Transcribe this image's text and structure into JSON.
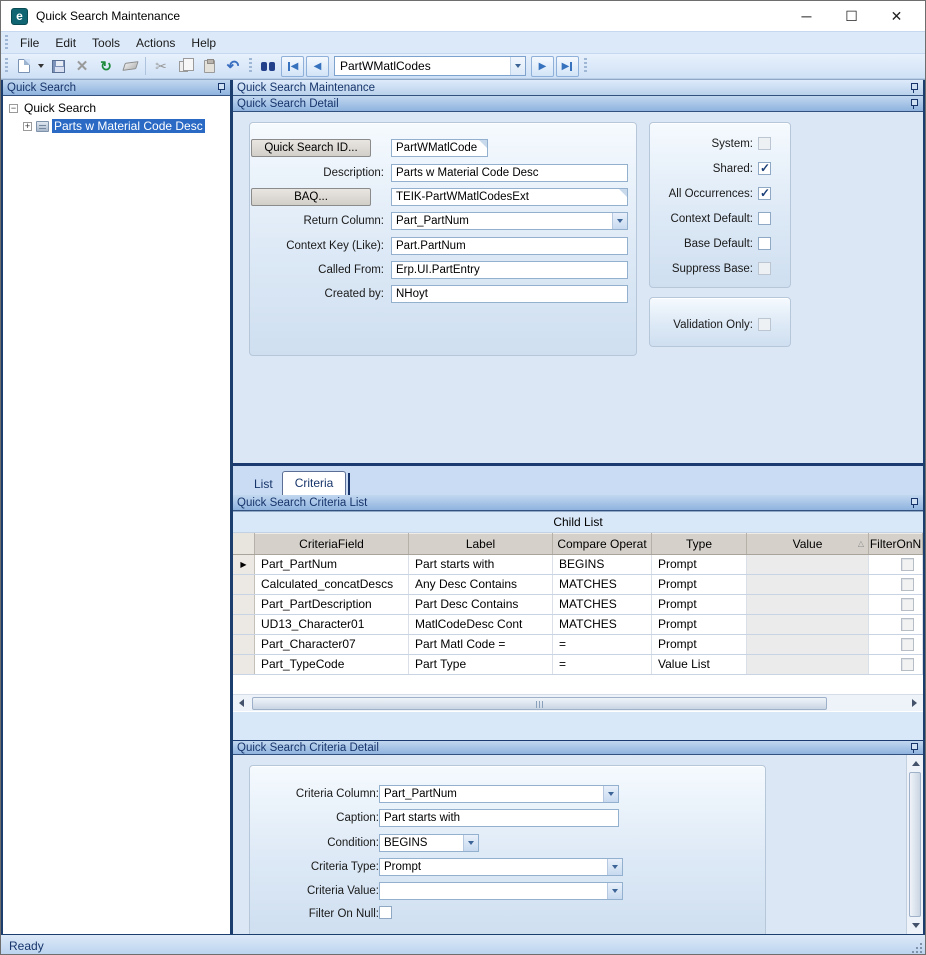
{
  "window": {
    "title": "Quick Search Maintenance",
    "status": "Ready"
  },
  "menu": {
    "items": [
      "File",
      "Edit",
      "Tools",
      "Actions",
      "Help"
    ]
  },
  "toolbar": {
    "record_combo_value": "PartWMatlCodes"
  },
  "tree": {
    "header": "Quick Search",
    "root_label": "Quick Search",
    "selected_node": "Parts w Material Code Desc"
  },
  "panel_headers": {
    "maintenance": "Quick Search Maintenance",
    "detail": "Quick Search Detail",
    "criteria_list": "Quick Search Criteria List",
    "criteria_detail": "Quick Search Criteria Detail"
  },
  "detail_form": {
    "id_button": "Quick Search ID...",
    "id_value": "PartWMatlCode",
    "description_label": "Description:",
    "description_value": "Parts w Material Code Desc",
    "baq_button": "BAQ...",
    "baq_value": "TEIK-PartWMatlCodesExt",
    "return_column_label": "Return Column:",
    "return_column_value": "Part_PartNum",
    "context_key_label": "Context Key (Like):",
    "context_key_value": "Part.PartNum",
    "called_from_label": "Called From:",
    "called_from_value": "Erp.UI.PartEntry",
    "created_by_label": "Created by:",
    "created_by_value": "NHoyt",
    "checkboxes": [
      {
        "label": "System:",
        "checked": false,
        "enabled": false
      },
      {
        "label": "Shared:",
        "checked": true,
        "enabled": true
      },
      {
        "label": "All Occurrences:",
        "checked": true,
        "enabled": true
      },
      {
        "label": "Context Default:",
        "checked": false,
        "enabled": true
      },
      {
        "label": "Base Default:",
        "checked": false,
        "enabled": true
      },
      {
        "label": "Suppress Base:",
        "checked": false,
        "enabled": false
      }
    ],
    "validation_only_label": "Validation Only:",
    "validation_only_checked": false
  },
  "tabs": [
    {
      "label": "List",
      "active": false
    },
    {
      "label": "Criteria",
      "active": true
    }
  ],
  "grid": {
    "band_title": "Child List",
    "columns": [
      "CriteriaField",
      "Label",
      "Compare Operat",
      "Type",
      "Value",
      "FilterOnN"
    ],
    "rows": [
      [
        "Part_PartNum",
        "Part starts with",
        "BEGINS",
        "Prompt",
        ""
      ],
      [
        "Calculated_concatDescs",
        "Any Desc Contains",
        "MATCHES",
        "Prompt",
        ""
      ],
      [
        "Part_PartDescription",
        "Part Desc Contains",
        "MATCHES",
        "Prompt",
        ""
      ],
      [
        "UD13_Character01",
        "MatlCodeDesc Cont",
        "MATCHES",
        "Prompt",
        ""
      ],
      [
        "Part_Character07",
        "Part Matl Code =",
        "=",
        "Prompt",
        ""
      ],
      [
        "Part_TypeCode",
        "Part Type",
        "=",
        "Value List",
        ""
      ]
    ]
  },
  "criteria_form": {
    "criteria_column_label": "Criteria Column:",
    "criteria_column_value": "Part_PartNum",
    "caption_label": "Caption:",
    "caption_value": "Part starts with",
    "condition_label": "Condition:",
    "condition_value": "BEGINS",
    "criteria_type_label": "Criteria Type:",
    "criteria_type_value": "Prompt",
    "criteria_value_label": "Criteria Value:",
    "criteria_value_value": "",
    "filter_on_null_label": "Filter On Null:",
    "filter_on_null_checked": false
  },
  "colors": {
    "selection_blue": "#2a6ac5",
    "header_text_navy": "#17356b",
    "navy_border": "#1c3e6e",
    "canvas_blue": "#dce7f5",
    "grid_header_gray": "#d5d1ca",
    "epicor_teal": "#0f6672"
  }
}
